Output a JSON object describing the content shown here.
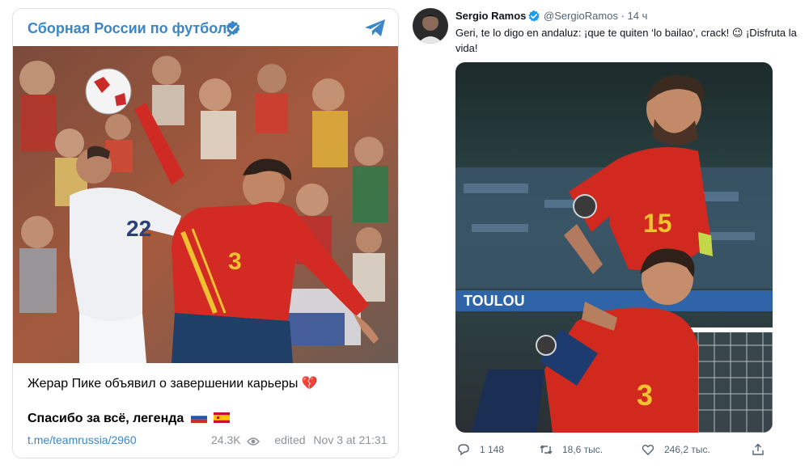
{
  "telegram": {
    "channel_title": "Сборная России по футболу",
    "photo_desc": "Player in red Spain jersey number 3 reaching for ball against player in white number 22",
    "post_line1": "Жерар Пике объявил о завершении карьеры",
    "post_line1_emoji": "💔",
    "post_line2": "Спасибо за всё, легенда",
    "link": "t.me/teamrussia/2960",
    "views": "24.3K",
    "edited_label": "edited",
    "date": "Nov 3 at 21:31",
    "colors": {
      "accent": "#3a86c8",
      "meta": "#8e9399"
    }
  },
  "tweet": {
    "name": "Sergio Ramos",
    "handle": "@SergioRamos",
    "time": "· 14 ч",
    "text": "Geri, te lo digo en andaluz: ¡que te quiten ‘lo bailao’, crack! 😉 ¡Disfruta la vida!",
    "photo_desc": "Spain player 15 celebrating on the back of Spain player 3 in stadium",
    "stadium_text": "TOULOU",
    "replies": "1 148",
    "retweets": "18,6 тыс.",
    "likes": "246,2 тыс.",
    "colors": {
      "text": "#0f1419",
      "secondary": "#536471",
      "verified": "#1d9bf0"
    }
  }
}
